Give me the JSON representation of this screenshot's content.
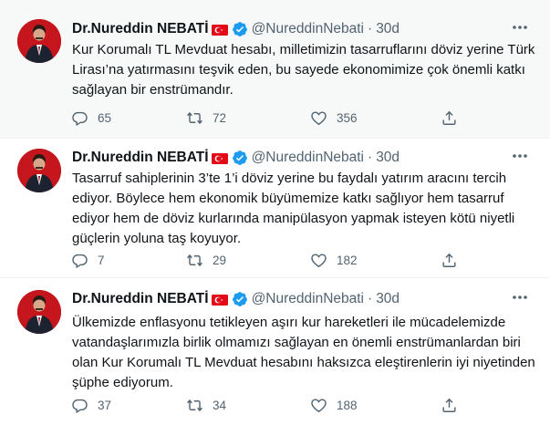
{
  "tweets": [
    {
      "name": "Dr.Nureddin NEBATİ",
      "handle": "@NureddinNebati",
      "separator": "·",
      "time": "30d",
      "lines": [
        "Kur Korumalı TL Mevduat hesabı, milletimizin tasarruflarını döviz yerine Türk",
        "Lirası’na yatırmasını teşvik eden, bu sayede ekonomimize çok önemli katkı",
        "sağlayan bir enstrümandır."
      ],
      "replies": "65",
      "retweets": "72",
      "likes": "356"
    },
    {
      "name": "Dr.Nureddin NEBATİ",
      "handle": "@NureddinNebati",
      "separator": "·",
      "time": "30d",
      "lines": [
        "Tasarruf sahiplerinin 3’te 1’i döviz yerine bu faydalı yatırım aracını tercih",
        "ediyor. Böylece hem ekonomik büyümemize katkı sağlıyor hem tasarruf",
        "ediyor hem de döviz kurlarında manipülasyon yapmak isteyen kötü niyetli",
        "güçlerin yoluna taş koyuyor."
      ],
      "replies": "7",
      "retweets": "29",
      "likes": "182"
    },
    {
      "name": "Dr.Nureddin NEBATİ",
      "handle": "@NureddinNebati",
      "separator": "·",
      "time": "30d",
      "lines": [
        "Ülkemizde enflasyonu tetikleyen aşırı kur hareketleri ile mücadelemizde",
        "vatandaşlarımızla birlik olmamızı sağlayan en önemli enstrümanlardan biri",
        "olan Kur Korumalı TL Mevduat hesabını haksızca eleştirenlerin iyi niyetinden",
        "şüphe ediyorum."
      ],
      "replies": "37",
      "retweets": "34",
      "likes": "188"
    }
  ],
  "icons": {
    "more": "more-icon",
    "reply": "reply-icon",
    "retweet": "retweet-icon",
    "like": "like-icon",
    "share": "share-icon",
    "verified": "verified-badge-icon",
    "flag": "turkish-flag-icon"
  },
  "colors": {
    "text": "#0f1419",
    "secondary": "#536471",
    "verified": "#1d9bf0",
    "flag": "#e30a17",
    "highlighted_row": "#f7f9f9",
    "divider": "#eff3f4"
  }
}
